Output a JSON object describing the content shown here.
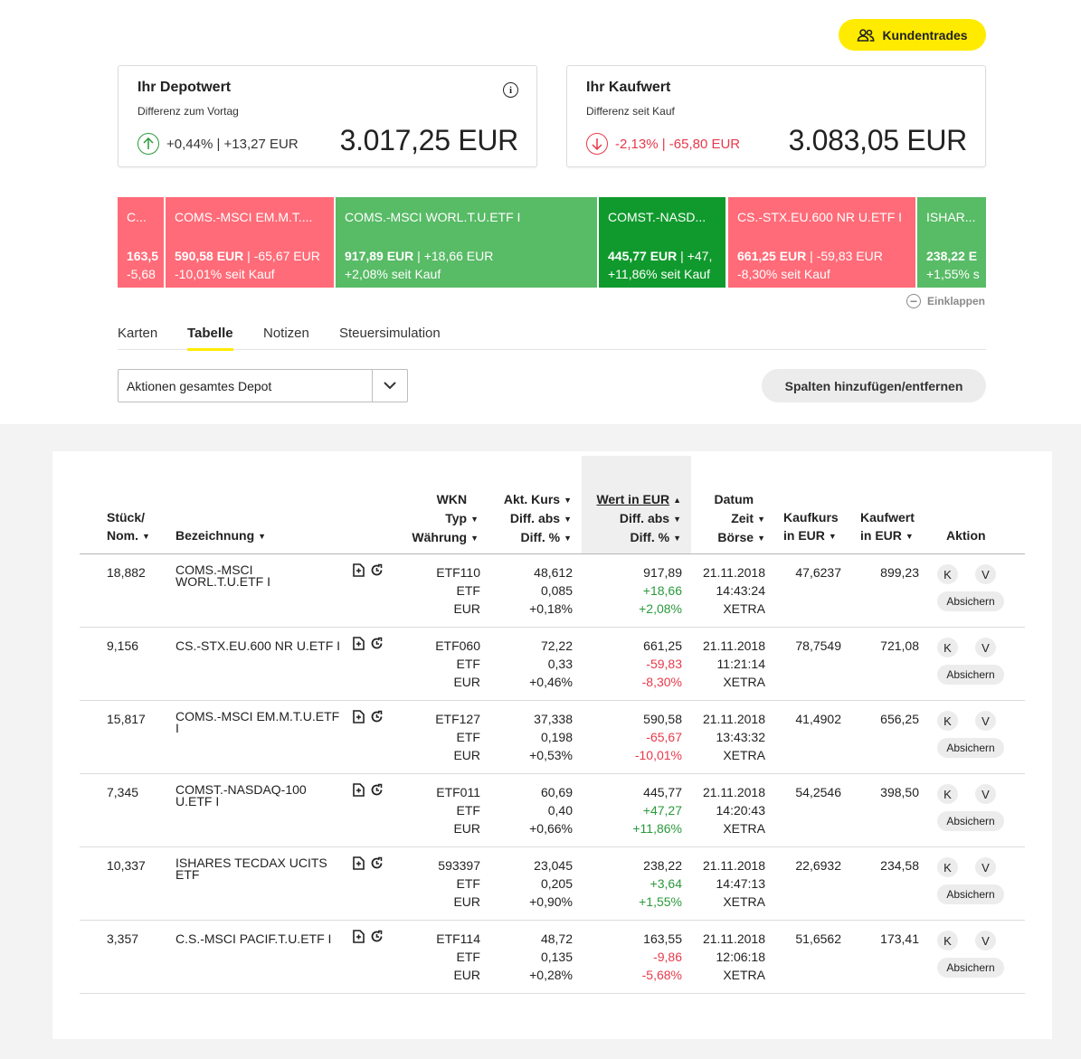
{
  "header": {
    "kundentrades_label": "Kundentrades"
  },
  "depot_card": {
    "title": "Ihr Depotwert",
    "subtitle": "Differenz zum Vortag",
    "diff": "+0,44% | +13,27 EUR",
    "value": "3.017,25 EUR",
    "info": "i"
  },
  "kauf_card": {
    "title": "Ihr Kaufwert",
    "subtitle": "Differenz seit Kauf",
    "diff": "-2,13% | -65,80 EUR",
    "value": "3.083,05 EUR"
  },
  "heatmap": [
    {
      "name": "C...",
      "line1_bold": "163,5",
      "line1_rest": "",
      "line2": "-5,68",
      "status": "negative",
      "color": "#ff6b78"
    },
    {
      "name": "COMS.-MSCI EM.M.T....",
      "line1_bold": "590,58 EUR",
      "line1_rest": " | -65,67 EUR",
      "line2": "-10,01% seit Kauf",
      "status": "negative",
      "color": "#ff6b78"
    },
    {
      "name": "COMS.-MSCI WORL.T.U.ETF I",
      "line1_bold": "917,89 EUR",
      "line1_rest": " | +18,66 EUR",
      "line2": "+2,08% seit Kauf",
      "status": "positive",
      "color": "#58bb66"
    },
    {
      "name": "COMST.-NASD...",
      "line1_bold": "445,77 EUR",
      "line1_rest": " | +47,",
      "line2": "+11,86% seit Kauf",
      "status": "strong-positive",
      "color": "#109a2d"
    },
    {
      "name": "CS.-STX.EU.600 NR U.ETF I",
      "line1_bold": "661,25 EUR",
      "line1_rest": " | -59,83 EUR",
      "line2": "-8,30% seit Kauf",
      "status": "negative",
      "color": "#ff6b78"
    },
    {
      "name": "ISHAR...",
      "line1_bold": "238,22 E",
      "line1_rest": "",
      "line2": "+1,55% s",
      "status": "positive",
      "color": "#58bb66"
    }
  ],
  "einklappen_label": "Einklappen",
  "tabs": [
    {
      "label": "Karten",
      "active": false
    },
    {
      "label": "Tabelle",
      "active": true
    },
    {
      "label": "Notizen",
      "active": false
    },
    {
      "label": "Steuersimulation",
      "active": false
    }
  ],
  "select": {
    "value": "Aktionen gesamtes Depot"
  },
  "spalten_label": "Spalten hinzufügen/entfernen",
  "table": {
    "headers": {
      "stueck": [
        "Stück/",
        "Nom."
      ],
      "bezeichnung": "Bezeichnung",
      "wkn": [
        "WKN",
        "Typ",
        "Währung"
      ],
      "kurs": [
        "Akt. Kurs",
        "Diff. abs",
        "Diff. %"
      ],
      "wert": [
        "Wert in EUR",
        "Diff. abs",
        "Diff. %"
      ],
      "datum": [
        "Datum",
        "Zeit",
        "Börse"
      ],
      "kaufkurs": [
        "Kaufkurs",
        "in EUR"
      ],
      "kaufwert": [
        "Kaufwert",
        "in EUR"
      ],
      "aktion": "Aktion"
    },
    "action_labels": {
      "k": "K",
      "v": "V",
      "absichern": "Absichern"
    },
    "rows": [
      {
        "stueck": "18,882",
        "name": "COMS.-MSCI WORL.T.U.ETF I",
        "wkn": "ETF110",
        "typ": "ETF",
        "waehrung": "EUR",
        "kurs": "48,612",
        "kurs_abs": "0,085",
        "kurs_pct": "+0,18%",
        "wert": "917,89",
        "wert_abs": "+18,66",
        "wert_pct": "+2,08%",
        "trend": "positive",
        "datum": "21.11.2018",
        "zeit": "14:43:24",
        "boerse": "XETRA",
        "kaufkurs": "47,6237",
        "kaufwert": "899,23"
      },
      {
        "stueck": "9,156",
        "name": "CS.-STX.EU.600 NR U.ETF I",
        "wkn": "ETF060",
        "typ": "ETF",
        "waehrung": "EUR",
        "kurs": "72,22",
        "kurs_abs": "0,33",
        "kurs_pct": "+0,46%",
        "wert": "661,25",
        "wert_abs": "-59,83",
        "wert_pct": "-8,30%",
        "trend": "negative",
        "datum": "21.11.2018",
        "zeit": "11:21:14",
        "boerse": "XETRA",
        "kaufkurs": "78,7549",
        "kaufwert": "721,08"
      },
      {
        "stueck": "15,817",
        "name": "COMS.-MSCI EM.M.T.U.ETF I",
        "wkn": "ETF127",
        "typ": "ETF",
        "waehrung": "EUR",
        "kurs": "37,338",
        "kurs_abs": "0,198",
        "kurs_pct": "+0,53%",
        "wert": "590,58",
        "wert_abs": "-65,67",
        "wert_pct": "-10,01%",
        "trend": "negative",
        "datum": "21.11.2018",
        "zeit": "13:43:32",
        "boerse": "XETRA",
        "kaufkurs": "41,4902",
        "kaufwert": "656,25"
      },
      {
        "stueck": "7,345",
        "name": "COMST.-NASDAQ-100 U.ETF I",
        "wkn": "ETF011",
        "typ": "ETF",
        "waehrung": "EUR",
        "kurs": "60,69",
        "kurs_abs": "0,40",
        "kurs_pct": "+0,66%",
        "wert": "445,77",
        "wert_abs": "+47,27",
        "wert_pct": "+11,86%",
        "trend": "positive",
        "datum": "21.11.2018",
        "zeit": "14:20:43",
        "boerse": "XETRA",
        "kaufkurs": "54,2546",
        "kaufwert": "398,50"
      },
      {
        "stueck": "10,337",
        "name": "ISHARES TECDAX UCITS ETF",
        "wkn": "593397",
        "typ": "ETF",
        "waehrung": "EUR",
        "kurs": "23,045",
        "kurs_abs": "0,205",
        "kurs_pct": "+0,90%",
        "wert": "238,22",
        "wert_abs": "+3,64",
        "wert_pct": "+1,55%",
        "trend": "positive",
        "datum": "21.11.2018",
        "zeit": "14:47:13",
        "boerse": "XETRA",
        "kaufkurs": "22,6932",
        "kaufwert": "234,58"
      },
      {
        "stueck": "3,357",
        "name": "C.S.-MSCI PACIF.T.U.ETF I",
        "wkn": "ETF114",
        "typ": "ETF",
        "waehrung": "EUR",
        "kurs": "48,72",
        "kurs_abs": "0,135",
        "kurs_pct": "+0,28%",
        "wert": "163,55",
        "wert_abs": "-9,86",
        "wert_pct": "-5,68%",
        "trend": "negative",
        "datum": "21.11.2018",
        "zeit": "12:06:18",
        "boerse": "XETRA",
        "kaufkurs": "51,6562",
        "kaufwert": "173,41"
      }
    ]
  }
}
